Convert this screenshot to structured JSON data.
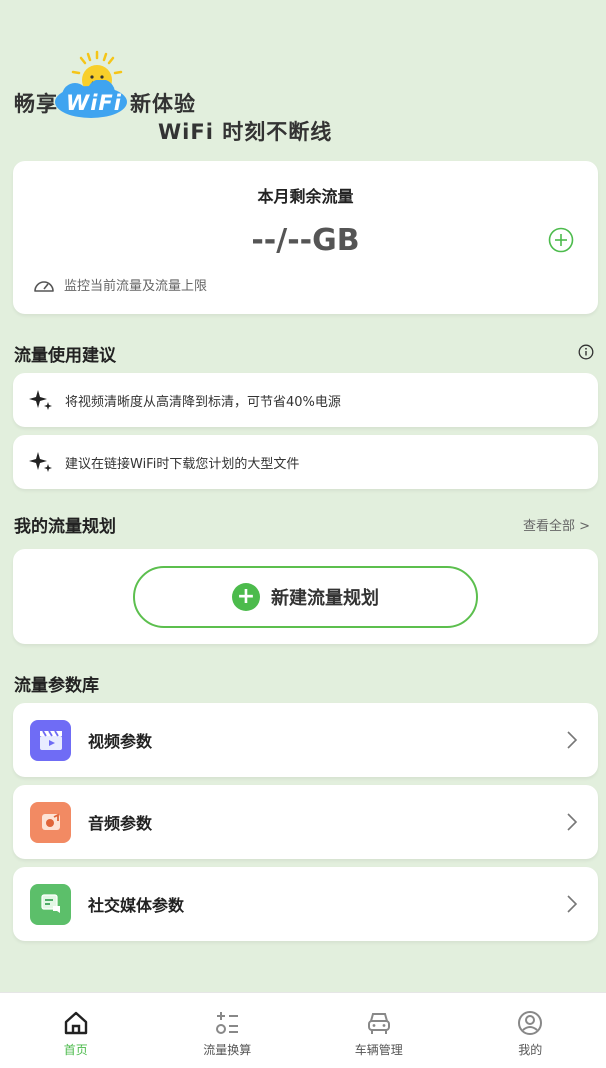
{
  "hero": {
    "prefix": "畅享",
    "badge": "WiFi",
    "suffix": "新体验",
    "subtitle": "WiFi 时刻不断线"
  },
  "traffic": {
    "title": "本月剩余流量",
    "value": "--/--GB",
    "monitor_text": "监控当前流量及流量上限",
    "add_icon": "plus-circle-icon"
  },
  "tips_section": {
    "title": "流量使用建议",
    "info_icon": "info-icon",
    "items": [
      {
        "icon": "sparkle-icon",
        "text": "将视频清晰度从高清降到标清，可节省40%电源"
      },
      {
        "icon": "sparkle-icon",
        "text": "建议在链接WiFi时下载您计划的大型文件"
      }
    ]
  },
  "plan_section": {
    "title": "我的流量规划",
    "see_all": "查看全部 >",
    "new_plan_label": "新建流量规划"
  },
  "params_section": {
    "title": "流量参数库",
    "items": [
      {
        "label": "视频参数",
        "icon": "video-clapper-icon",
        "color": "#6f6cf5"
      },
      {
        "label": "音频参数",
        "icon": "audio-speaker-icon",
        "color": "#f28a63"
      },
      {
        "label": "社交媒体参数",
        "icon": "social-chat-icon",
        "color": "#5cbf6a"
      }
    ]
  },
  "tabbar": {
    "items": [
      {
        "label": "首页",
        "icon": "home-icon",
        "active": true
      },
      {
        "label": "流量换算",
        "icon": "calculator-icon",
        "active": false
      },
      {
        "label": "车辆管理",
        "icon": "car-icon",
        "active": false
      },
      {
        "label": "我的",
        "icon": "profile-icon",
        "active": false
      }
    ]
  },
  "colors": {
    "background": "#e2efdd",
    "accent": "#4cbb4c",
    "card": "#ffffff"
  }
}
